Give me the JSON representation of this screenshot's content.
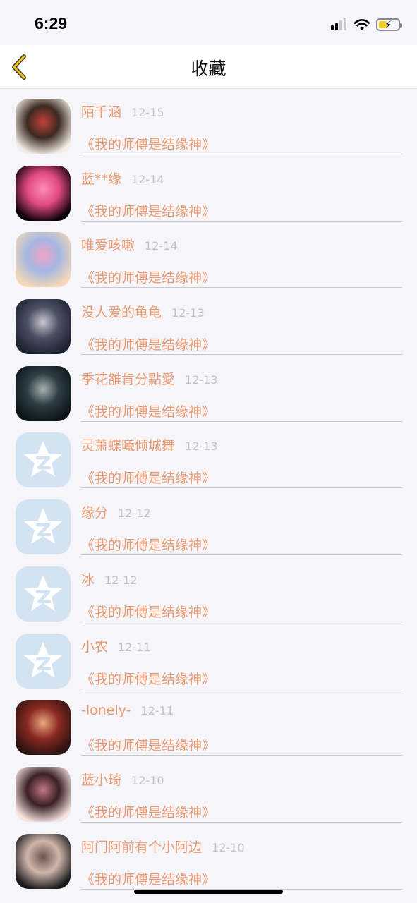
{
  "status_bar": {
    "time": "6:29"
  },
  "nav": {
    "title": "收藏"
  },
  "list": [
    {
      "name": "陌千涵",
      "date": "12-15",
      "favorite": "《我的师傅是结缘神》",
      "avatar": "photo",
      "palette": [
        "#f1ede4",
        "#3b2a20",
        "#c2413a"
      ]
    },
    {
      "name": "蓝**缘",
      "date": "12-14",
      "favorite": "《我的师傅是结缘神》",
      "avatar": "photo",
      "palette": [
        "#0b0006",
        "#e04a83",
        "#ff8bb4"
      ]
    },
    {
      "name": "唯爱咳嗽",
      "date": "12-14",
      "favorite": "《我的师傅是结缘神》",
      "avatar": "photo",
      "palette": [
        "#f3d8b7",
        "#a4b6e2",
        "#f2a3c7"
      ]
    },
    {
      "name": "没人爱的龟龟",
      "date": "12-13",
      "favorite": "《我的师傅是结缘神》",
      "avatar": "photo",
      "palette": [
        "#1d2230",
        "#4a4f63",
        "#c9c6cd"
      ]
    },
    {
      "name": "季花雒肯分點愛",
      "date": "12-13",
      "favorite": "《我的师傅是结缘神》",
      "avatar": "photo",
      "palette": [
        "#0c1418",
        "#2c3e44",
        "#a7b0ae"
      ]
    },
    {
      "name": "灵萧蝶曦倾城舞",
      "date": "12-13",
      "favorite": "《我的师傅是结缘神》",
      "avatar": "qq"
    },
    {
      "name": "缘分",
      "date": "12-12",
      "favorite": "《我的师傅是结缘神》",
      "avatar": "qq"
    },
    {
      "name": "冰",
      "date": "12-12",
      "favorite": "《我的师傅是结缘神》",
      "avatar": "qq"
    },
    {
      "name": "小农",
      "date": "12-11",
      "favorite": "《我的师傅是结缘神》",
      "avatar": "qq"
    },
    {
      "name": "-lonely-",
      "date": "12-11",
      "favorite": "《我的师傅是结缘神》",
      "avatar": "photo",
      "palette": [
        "#2a1210",
        "#8a2a22",
        "#e8a77e"
      ]
    },
    {
      "name": "蓝小琦",
      "date": "12-10",
      "favorite": "《我的师傅是结缘神》",
      "avatar": "photo",
      "palette": [
        "#f6e4e0",
        "#3a2024",
        "#c07880"
      ]
    },
    {
      "name": "阿门阿前有个小阿边",
      "date": "12-10",
      "favorite": "《我的师傅是结缘神》",
      "avatar": "photo",
      "palette": [
        "#1a1a1c",
        "#cfb6aa",
        "#6c5550"
      ]
    }
  ]
}
